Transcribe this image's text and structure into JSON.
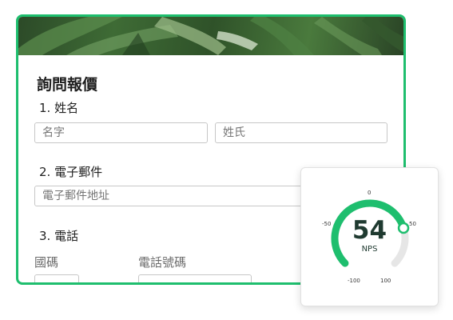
{
  "form": {
    "title": "詢問報價",
    "q1_label": "1. 姓名",
    "first_name_placeholder": "名字",
    "last_name_placeholder": "姓氏",
    "q2_label": "2. 電子郵件",
    "email_placeholder": "電子郵件地址",
    "q3_label": "3. 電話",
    "country_code_label": "國碼",
    "phone_number_label": "電話號碼",
    "accent_color": "#1ebe6e"
  },
  "nps_widget": {
    "value": "54",
    "label": "NPS",
    "score": 54,
    "min": -100,
    "max": 100,
    "ticks": [
      "0",
      "-50",
      "50",
      "-100",
      "100"
    ],
    "gauge_color": "#1ebe6e",
    "track_color": "#e6e6e6"
  }
}
